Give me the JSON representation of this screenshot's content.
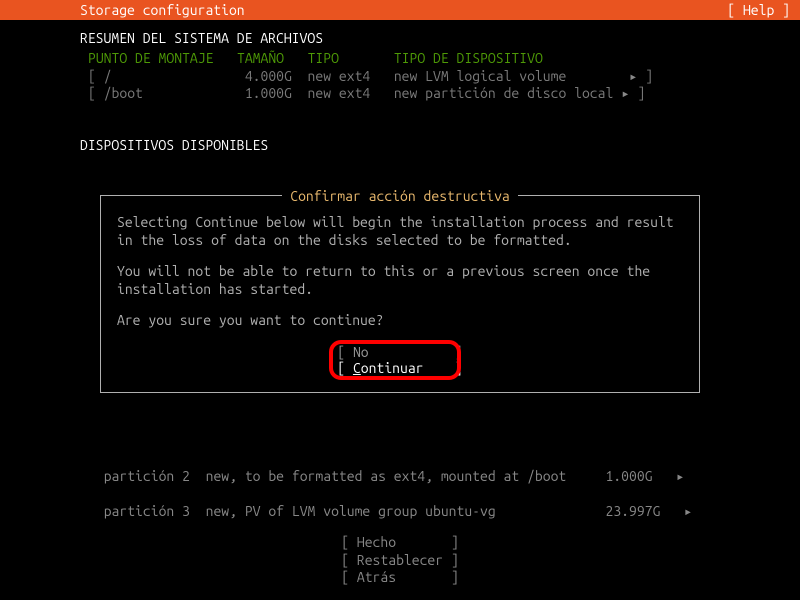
{
  "header": {
    "title": "Storage configuration",
    "help": "[ Help ]"
  },
  "fs_summary": {
    "title": "RESUMEN DEL SISTEMA DE ARCHIVOS",
    "headers": {
      "mount": "PUNTO DE MONTAJE",
      "size": "TAMAÑO",
      "type": "TIPO",
      "devtype": "TIPO DE DISPOSITIVO"
    },
    "rows": [
      {
        "mount": "/",
        "size": "4.000G",
        "type": "new ext4",
        "devtype": "new LVM logical volume"
      },
      {
        "mount": "/boot",
        "size": "1.000G",
        "type": "new ext4",
        "devtype": "new partición de disco local"
      }
    ]
  },
  "available": {
    "title": "DISPOSITIVOS DISPONIBLES"
  },
  "dialog": {
    "title": "Confirmar acción destructiva",
    "p1": "Selecting Continue below will begin the installation process and result in the loss of data on the disks selected to be formatted.",
    "p2": "You will not be able to return to this or a previous screen once the installation has started.",
    "p3": "Are you sure you want to continue?",
    "no": "No",
    "continuar": "Continuar"
  },
  "partitions": [
    {
      "name": "partición 2",
      "desc": "new, to be formatted as ext4, mounted at /boot",
      "size": "1.000G"
    },
    {
      "name": "partición 3",
      "desc": "new, PV of LVM volume group ubuntu-vg",
      "size": "23.997G"
    }
  ],
  "bottom": {
    "done": "Hecho",
    "reset": "Restablecer",
    "back": "Atrás"
  }
}
